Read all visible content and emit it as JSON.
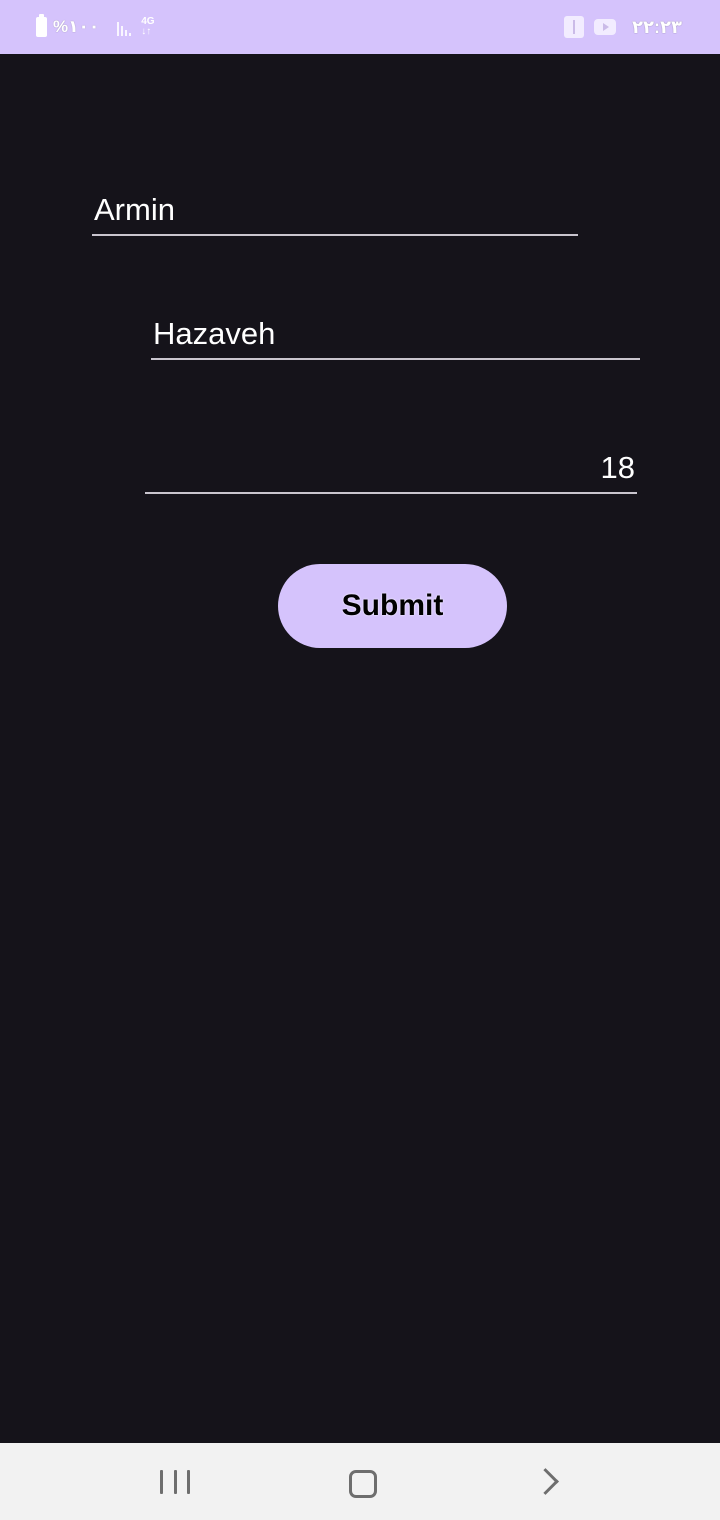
{
  "status_bar": {
    "battery_text": "%۱۰۰",
    "network_type": "4G",
    "clock": "۲۲:۲۳",
    "background_color": "#d5c3fc",
    "icons": [
      "battery-icon",
      "signal-icon",
      "network-4g-icon",
      "usb-icon",
      "youtube-icon"
    ]
  },
  "form": {
    "first_name": {
      "value": "Armin"
    },
    "last_name": {
      "value": "Hazaveh"
    },
    "age": {
      "value": "18"
    },
    "submit_label": "Submit"
  },
  "nav_bar": {
    "icons": [
      "recents-icon",
      "home-icon",
      "back-icon"
    ]
  },
  "colors": {
    "background": "#15131a",
    "accent": "#d5c3fc",
    "field_underline": "#c9c5ce",
    "nav_background": "#f2f2f2"
  }
}
